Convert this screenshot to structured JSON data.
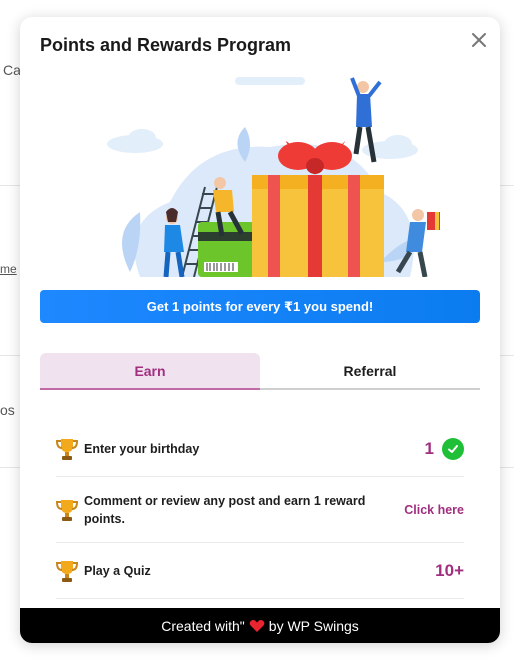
{
  "background": {
    "frag1": "Ca",
    "frag2": "me",
    "frag3": "os"
  },
  "modal": {
    "title": "Points and Rewards Program",
    "close_icon": "close-icon",
    "promo": "Get 1 points for every ₹1 you spend!",
    "tabs": [
      {
        "label": "Earn",
        "active": true
      },
      {
        "label": "Referral",
        "active": false
      }
    ],
    "earn_items": [
      {
        "label": "Enter your birthday",
        "value": "1",
        "icon": "trophy-icon",
        "done": true
      },
      {
        "label": "Comment or review any post and earn 1 reward points.",
        "link": "Click here",
        "icon": "trophy-icon"
      },
      {
        "label": "Play a Quiz",
        "value": "10+",
        "icon": "trophy-icon"
      }
    ],
    "footer": {
      "prefix": "Created with\"",
      "suffix": "by WP Swings",
      "heart_icon": "heart-icon"
    }
  },
  "colors": {
    "accent": "#a0307f",
    "tab_active_bg": "#f1e2ef",
    "banner": "#1e88ff",
    "check": "#1fc037"
  }
}
